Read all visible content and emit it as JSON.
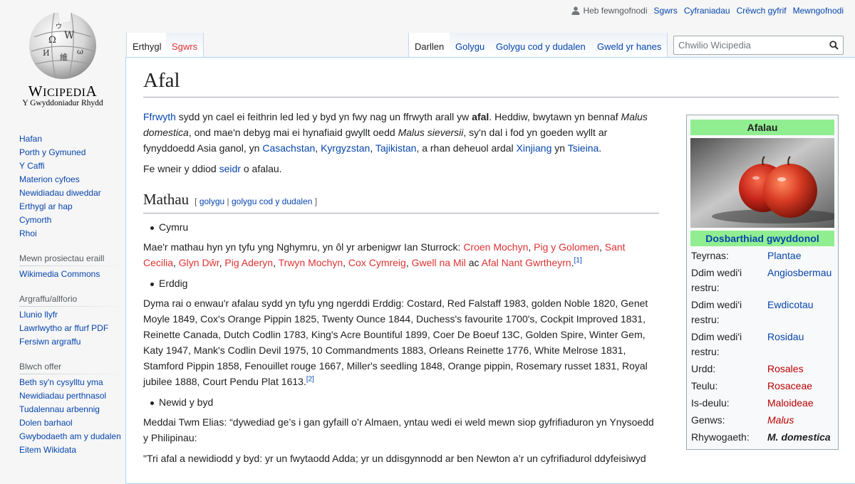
{
  "logo": {
    "wordmark_a": "W",
    "wordmark_b": "ICIPEDI",
    "wordmark_c": "A",
    "tagline": "Y Gwyddoniadur Rhydd"
  },
  "personal": {
    "user": "Heb fewngofnodi",
    "links": [
      "Sgwrs",
      "Cyfraniadau",
      "Crëwch gyfrif",
      "Mewngofnodi"
    ]
  },
  "tabs": {
    "article": "Erthygl",
    "talk": "Sgwrs",
    "read": "Darllen",
    "edit": "Golygu",
    "edit_source": "Golygu cod y dudalen",
    "history": "Gweld yr hanes"
  },
  "search": {
    "placeholder": "Chwilio Wicipedia"
  },
  "sidebar": {
    "nav": [
      "Hafan",
      "Porth y Gymuned",
      "Y Caffi",
      "Materion cyfoes",
      "Newidiadau diweddar",
      "Erthygl ar hap",
      "Cymorth",
      "Rhoi"
    ],
    "projects_heading": "Mewn prosiectau eraill",
    "projects": [
      "Wikimedia Commons"
    ],
    "print_heading": "Argraffu/allforio",
    "print": [
      "Llunio llyfr",
      "Lawrlwytho ar ffurf PDF",
      "Fersiwn argraffu"
    ],
    "tools_heading": "Blwch offer",
    "tools": [
      "Beth sy'n cysylltu yma",
      "Newidiadau perthnasol",
      "Tudalennau arbennig",
      "Dolen barhaol",
      "Gwybodaeth am y dudalen",
      "Eitem Wikidata"
    ]
  },
  "article": {
    "title": "Afal",
    "intro": {
      "t1": "Ffrwyth",
      "t2": " sydd yn cael ei feithrin led led y byd yn fwy nag un ffrwyth arall yw ",
      "t3": "afal",
      "t4": ". Heddiw, bwytawn yn bennaf ",
      "t5": "Malus domestica",
      "t6": ", ond mae'n debyg mai ei hynafiaid gwyllt oedd ",
      "t7": "Malus sieversii",
      "t8": ", sy'n dal i fod yn goeden wyllt ar fynyddoedd Asia ganol, yn ",
      "t9": "Casachstan",
      "t10": ", ",
      "t11": "Kyrgyzstan",
      "t12": ", ",
      "t13": "Tajikistan",
      "t14": ", a rhan deheuol ardal ",
      "t15": "Xinjiang",
      "t16": " yn ",
      "t17": "Tsieina",
      "t18": "."
    },
    "p2": {
      "a": "Fe wneir y ddiod ",
      "b": "seidr",
      "c": " o afalau."
    },
    "section": {
      "title": "Mathau",
      "edit_open": "[ ",
      "edit": "golygu",
      "sep": " | ",
      "edit_src": "golygu cod y dudalen",
      "edit_close": " ]"
    },
    "cymru": {
      "bullet": "Cymru",
      "lead": "Mae'r mathau hyn yn tyfu yng Nghymru, yn ôl yr arbenigwr Ian Sturrock: ",
      "v1": "Croen Mochyn",
      "v2": "Pig y Golomen",
      "v3": "Sant Cecilia",
      "v4": "Glyn Dŵr",
      "v5": "Pig Aderyn",
      "v6": "Trwyn Mochyn",
      "v7": "Cox Cymreig",
      "v8": "Gwell na Mil",
      "v9": "Afal Nant Gwrtheyrn",
      "comma": ", ",
      "ac": " ac ",
      "end": ".",
      "ref": "[1]"
    },
    "erddig": {
      "bullet": "Erddig",
      "text": "Dyma rai o enwau'r afalau sydd yn tyfu yng ngerddi Erddig: Costard, Red Falstaff 1983, golden Noble 1820, Genet Moyle 1849, Cox's Orange Pippin 1825, Twenty Ounce 1844, Duchess's favourite 1700's, Cockpit Improved 1831, Reinette Canada, Dutch Codlin 1783, King's Acre Bountiful 1899, Coer De Boeuf 13C, Golden Spire, Winter Gem, Katy 1947, Mank's Codlin Devil 1975, 10 Commandments 1883, Orleans Reinette 1776, White Melrose 1831, Stamford Pippin 1858, Fenouillet rouge 1667, Miller's seedling 1848, Orange pippin, Rosemary russet 1831, Royal jubilee 1888, Court Pendu Plat 1613.",
      "ref": "[2]"
    },
    "newid": {
      "bullet": "Newid y byd",
      "text": "Meddai Twm Elias: “dywediad ge’s i gan gyfaill o’r Almaen, yntau wedi ei weld mewn siop gyfrifiaduron yn Ynysoedd y Philipinau:",
      "quote": "\"Tri afal a newidiodd y byd: yr un fwytaodd Adda; yr un ddisgynnodd ar ben Newton a’r un cyfrifiadurol ddyfeisiwyd"
    }
  },
  "infobox": {
    "title": "Afalau",
    "classification": "Dosbarthiad gwyddonol",
    "rows": [
      {
        "k": "Teyrnas:",
        "v": "Plantae",
        "style": "link"
      },
      {
        "k": "Ddim wedi'i restru:",
        "v": "Angiosbermau",
        "style": "link"
      },
      {
        "k": "Ddim wedi'i restru:",
        "v": "Ewdicotau",
        "style": "link"
      },
      {
        "k": "Ddim wedi'i restru:",
        "v": "Rosidau",
        "style": "link"
      },
      {
        "k": "Urdd:",
        "v": "Rosales",
        "style": "red"
      },
      {
        "k": "Teulu:",
        "v": "Rosaceae",
        "style": "red"
      },
      {
        "k": "Is-deulu:",
        "v": "Maloideae",
        "style": "red"
      },
      {
        "k": "Genws:",
        "v": "Malus",
        "style": "red-italic"
      },
      {
        "k": "Rhywogaeth:",
        "v": "M. domestica",
        "style": "bold-italic"
      }
    ]
  }
}
